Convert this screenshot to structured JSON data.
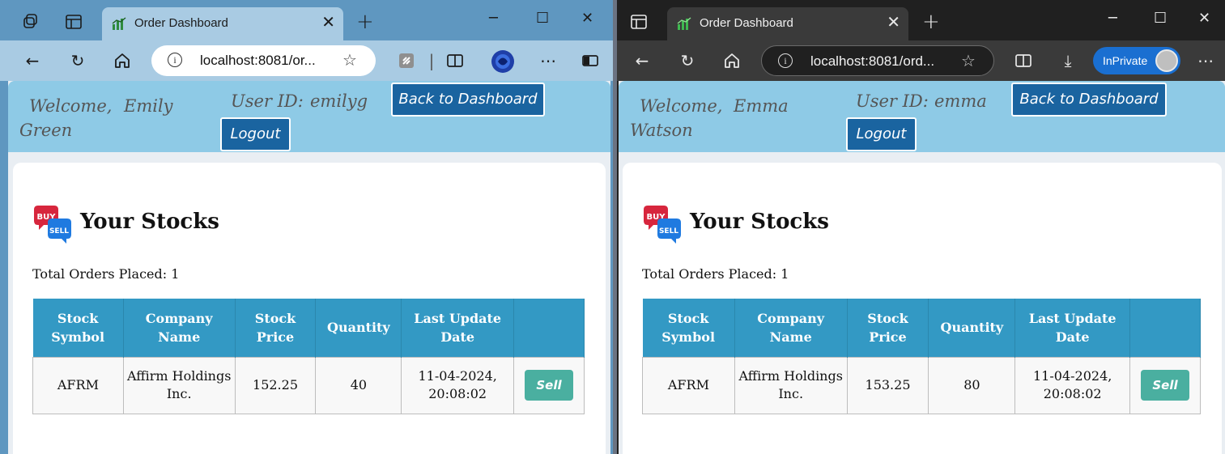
{
  "windows": {
    "left": {
      "tab_title": "Order Dashboard",
      "address": "localhost:8081/or...",
      "header": {
        "welcome": "Welcome,",
        "first_name": "Emily",
        "last_name": "Green",
        "user_id_label": "User ID:",
        "user_id": "emilyg",
        "back_button": "Back to Dashboard",
        "logout_button": "Logout"
      },
      "stocks_title": "Your Stocks",
      "total_orders": "Total Orders Placed: 1",
      "table": {
        "headers": [
          "Stock Symbol",
          "Company Name",
          "Stock Price",
          "Quantity",
          "Last Update Date",
          ""
        ],
        "rows": [
          {
            "symbol": "AFRM",
            "company": "Affirm Holdings Inc.",
            "price": "152.25",
            "quantity": "40",
            "date": "11-04-2024, 20:08:02",
            "action": "Sell"
          }
        ]
      }
    },
    "right": {
      "tab_title": "Order Dashboard",
      "address": "localhost:8081/ord...",
      "inprivate_label": "InPrivate",
      "header": {
        "welcome": "Welcome,",
        "first_name": "Emma",
        "last_name": "Watson",
        "user_id_label": "User ID:",
        "user_id": "emma",
        "back_button": "Back to Dashboard",
        "logout_button": "Logout"
      },
      "stocks_title": "Your Stocks",
      "total_orders": "Total Orders Placed: 1",
      "table": {
        "headers": [
          "Stock Symbol",
          "Company Name",
          "Stock Price",
          "Quantity",
          "Last Update Date",
          ""
        ],
        "rows": [
          {
            "symbol": "AFRM",
            "company": "Affirm Holdings Inc.",
            "price": "153.25",
            "quantity": "80",
            "date": "11-04-2024, 20:08:02",
            "action": "Sell"
          }
        ]
      }
    }
  },
  "icons": {
    "buy_sell_badge": {
      "top": "BUY",
      "bottom": "SELL"
    },
    "favicon": "bar-chart-icon"
  },
  "colors": {
    "header_bg": "#8ecae6",
    "button_bg": "#1a64a0",
    "table_header": "#3399c4",
    "sell_button": "#4aafa0",
    "inprivate": "#1a6fd1"
  }
}
